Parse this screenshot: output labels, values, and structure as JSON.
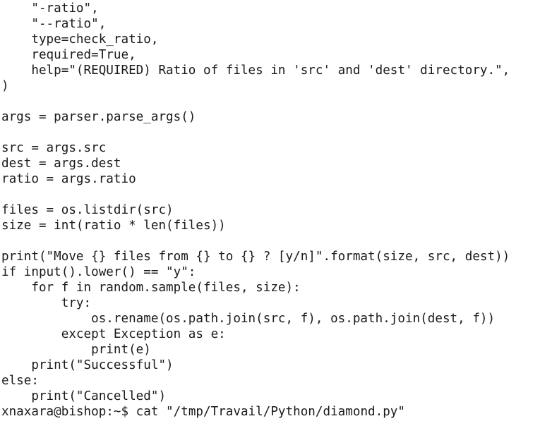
{
  "terminal": {
    "lines": [
      "    \"-ratio\",",
      "    \"--ratio\",",
      "    type=check_ratio,",
      "    required=True,",
      "    help=\"(REQUIRED) Ratio of files in 'src' and 'dest' directory.\",",
      ")",
      "",
      "args = parser.parse_args()",
      "",
      "src = args.src",
      "dest = args.dest",
      "ratio = args.ratio",
      "",
      "files = os.listdir(src)",
      "size = int(ratio * len(files))",
      "",
      "print(\"Move {} files from {} to {} ? [y/n]\".format(size, src, dest))",
      "if input().lower() == \"y\":",
      "    for f in random.sample(files, size):",
      "        try:",
      "            os.rename(os.path.join(src, f), os.path.join(dest, f))",
      "        except Exception as e:",
      "            print(e)",
      "    print(\"Successful\")",
      "else:",
      "    print(\"Cancelled\")"
    ],
    "prompt": {
      "user_host": "xnaxara@bishop",
      "path": "~",
      "symbol": "$",
      "command": "cat \"/tmp/Travail/Python/diamond.py\""
    }
  }
}
